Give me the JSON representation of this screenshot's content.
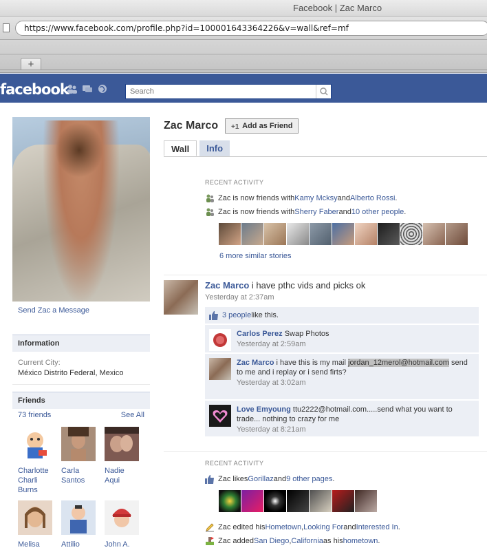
{
  "browser": {
    "window_title": "Facebook | Zac Marco",
    "url": "https://www.facebook.com/profile.php?id=100001643364226&v=wall&ref=mf",
    "newtab_label": "+"
  },
  "header": {
    "logo": "facebook",
    "search_placeholder": "Search"
  },
  "profile": {
    "name": "Zac Marco",
    "add_friend_label": "Add as Friend",
    "send_message": "Send Zac a Message"
  },
  "tabs": [
    {
      "label": "Wall"
    },
    {
      "label": "Info"
    }
  ],
  "info": {
    "title": "Information",
    "city_label": "Current City:",
    "city_value": "México Distrito Federal, Mexico"
  },
  "friends": {
    "title": "Friends",
    "count": "73 friends",
    "see_all": "See All",
    "list": [
      {
        "name": "Charlotte Charli Burns"
      },
      {
        "name": "Carla Santos"
      },
      {
        "name": "Nadie Aqui"
      },
      {
        "name": "Melisa Yuldiz"
      },
      {
        "name": "Attilio Perte'"
      },
      {
        "name": "John A. Smith"
      }
    ]
  },
  "recent1": {
    "label": "RECENT ACTIVITY",
    "line1_pre": "Zac is now friends with ",
    "line1_a": "Kamy Mcksy",
    "line1_and": " and ",
    "line1_b": "Alberto Rossi",
    "line1_end": ".",
    "line2_pre": "Zac is now friends with ",
    "line2_a": "Sherry Faber",
    "line2_and": " and ",
    "line2_b": "10 other people",
    "line2_end": ".",
    "more": "6 more similar stories"
  },
  "post": {
    "author": "Zac Marco",
    "text": " i have pthc vids and picks ok",
    "time": "Yesterday at 2:37am",
    "likes": "3 people",
    "likes_suffix": " like this.",
    "comments": [
      {
        "author": "Carlos Perez",
        "text": " Swap Photos",
        "highlight": "",
        "after": "",
        "time": "Yesterday at 2:59am"
      },
      {
        "author": "Zac Marco",
        "text": " i have this is my mail ",
        "highlight": "jordan_12merol@hotmail.com",
        "after": " send to me and i replay or i send firts?",
        "time": "Yesterday at 3:02am"
      },
      {
        "author": "Love Emyoung",
        "text": " ttu2222@hotmail.com.....send what you want to trade... nothing to crazy for me",
        "highlight": "",
        "after": "",
        "time": "Yesterday at 8:21am"
      }
    ]
  },
  "recent2": {
    "label": "RECENT ACTIVITY",
    "likes_pre": "Zac likes ",
    "likes_a": "Gorillaz",
    "likes_and": " and ",
    "likes_b": "9 other pages",
    "likes_end": ".",
    "edited_pre": "Zac edited his ",
    "edited_a": "Hometown",
    "edited_sep": ", ",
    "edited_b": "Looking For",
    "edited_and": " and ",
    "edited_c": "Interested In",
    "edited_end": ".",
    "added_pre": "Zac added ",
    "added_a": "San Diego",
    "added_sep": ", ",
    "added_b": "California",
    "added_mid": " as his ",
    "added_c": "hometown",
    "added_end": "."
  },
  "colors": {
    "brand": "#3b5998",
    "panel": "#eceff5"
  }
}
